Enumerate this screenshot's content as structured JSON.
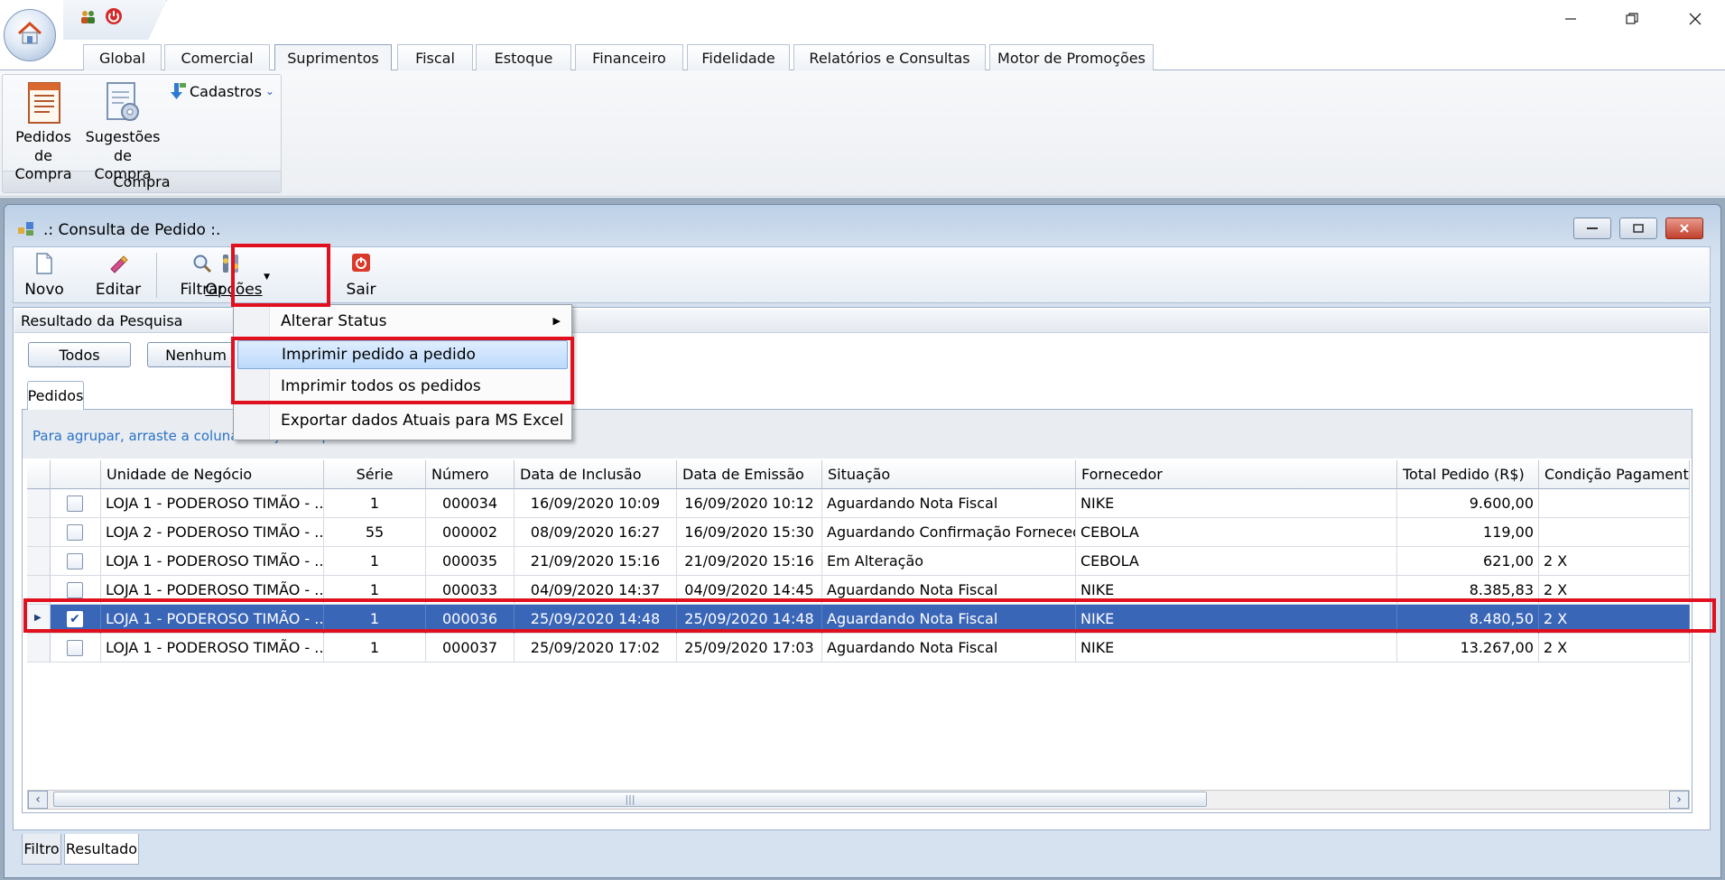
{
  "ribbon": {
    "tabs": [
      "Global",
      "Comercial",
      "Suprimentos",
      "Fiscal",
      "Estoque",
      "Financeiro",
      "Fidelidade",
      "Relatórios e Consultas",
      "Motor de Promoções"
    ],
    "buttons": {
      "pedidos_line1": "Pedidos",
      "pedidos_line2": "de Compra",
      "sugestoes_line1": "Sugestões",
      "sugestoes_line2": "de Compra",
      "cadastros": "Cadastros"
    },
    "group_label": "Compra"
  },
  "window": {
    "title": ".: Consulta de Pedido :."
  },
  "toolbar": {
    "novo": "Novo",
    "editar": "Editar",
    "filtrar": "Filtrar",
    "opcoes": "Opções",
    "sair": "Sair"
  },
  "menu": {
    "alterar_status": "Alterar Status",
    "imprimir_pedido": "Imprimir pedido a pedido",
    "imprimir_todos": "Imprimir todos os pedidos",
    "exportar": "Exportar dados Atuais para MS Excel"
  },
  "results": {
    "section_title": "Resultado da Pesquisa",
    "btn_todos": "Todos",
    "btn_nenhum": "Nenhum",
    "tab_pedidos": "Pedidos",
    "group_hint": "Para agrupar, arraste a coluna desejada aqui..."
  },
  "grid": {
    "columns": [
      "Unidade de Negócio",
      "Série",
      "Número",
      "Data de Inclusão",
      "Data de Emissão",
      "Situação",
      "Fornecedor",
      "Total Pedido (R$)",
      "Condição Pagamento"
    ],
    "rows": [
      {
        "unidade": "LOJA 1 - PODEROSO TIMÃO - ...",
        "serie": "1",
        "numero": "000034",
        "inclusao": "16/09/2020 10:09",
        "emissao": "16/09/2020 10:12",
        "situacao": "Aguardando Nota Fiscal",
        "fornecedor": "NIKE",
        "total": "9.600,00",
        "condicao": "",
        "checked": false,
        "selected": false
      },
      {
        "unidade": "LOJA 2 - PODEROSO TIMÃO - ...",
        "serie": "55",
        "numero": "000002",
        "inclusao": "08/09/2020 16:27",
        "emissao": "16/09/2020 15:30",
        "situacao": "Aguardando Confirmação Fornecedor",
        "fornecedor": "CEBOLA",
        "total": "119,00",
        "condicao": "",
        "checked": false,
        "selected": false
      },
      {
        "unidade": "LOJA 1 - PODEROSO TIMÃO - ...",
        "serie": "1",
        "numero": "000035",
        "inclusao": "21/09/2020 15:16",
        "emissao": "21/09/2020 15:16",
        "situacao": "Em Alteração",
        "fornecedor": "CEBOLA",
        "total": "621,00",
        "condicao": "2 X",
        "checked": false,
        "selected": false
      },
      {
        "unidade": "LOJA 1 - PODEROSO TIMÃO - ...",
        "serie": "1",
        "numero": "000033",
        "inclusao": "04/09/2020 14:37",
        "emissao": "04/09/2020 14:45",
        "situacao": "Aguardando Nota Fiscal",
        "fornecedor": "NIKE",
        "total": "8.385,83",
        "condicao": "2 X",
        "checked": false,
        "selected": false
      },
      {
        "unidade": "LOJA 1 - PODEROSO TIMÃO - ...",
        "serie": "1",
        "numero": "000036",
        "inclusao": "25/09/2020 14:48",
        "emissao": "25/09/2020 14:48",
        "situacao": "Aguardando Nota Fiscal",
        "fornecedor": "NIKE",
        "total": "8.480,50",
        "condicao": "2 X",
        "checked": true,
        "selected": true
      },
      {
        "unidade": "LOJA 1 - PODEROSO TIMÃO - ...",
        "serie": "1",
        "numero": "000037",
        "inclusao": "25/09/2020 17:02",
        "emissao": "25/09/2020 17:03",
        "situacao": "Aguardando Nota Fiscal",
        "fornecedor": "NIKE",
        "total": "13.267,00",
        "condicao": "2 X",
        "checked": false,
        "selected": false
      }
    ]
  },
  "bottom_tabs": {
    "filtro": "Filtro",
    "resultado": "Resultado"
  },
  "colors": {
    "selection": "#3a66b8",
    "highlight_border": "#e0101e",
    "group_hint_text": "#2a73c9"
  },
  "icons": [
    "home-icon",
    "users-icon",
    "power-icon",
    "minimize-icon",
    "restore-icon",
    "close-icon",
    "document-icon",
    "gear-document-icon",
    "arrow-down-icon",
    "new-document-icon",
    "edit-icon",
    "search-icon",
    "options-icon",
    "exit-icon",
    "submenu-arrow-icon",
    "row-pointer-icon",
    "check-icon"
  ]
}
